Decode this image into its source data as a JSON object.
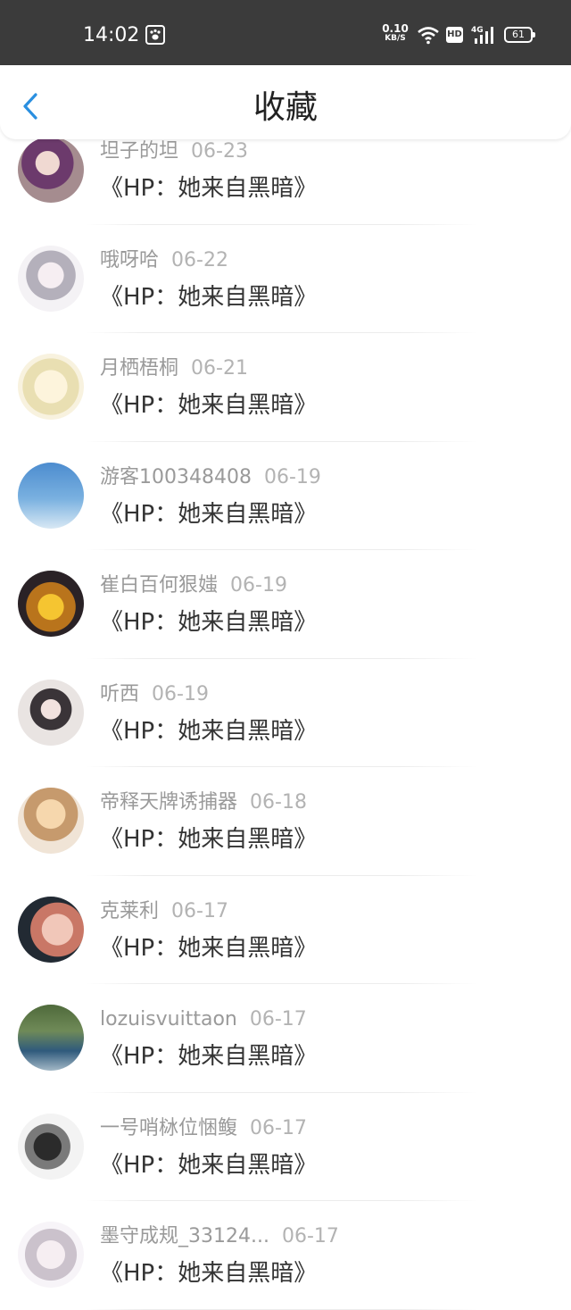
{
  "status_bar": {
    "time": "14:02",
    "net_speed": "0.10",
    "net_unit": "KB/S",
    "hd_label": "HD",
    "network": "4G",
    "battery": "61"
  },
  "header": {
    "title": "收藏"
  },
  "favorites": [
    {
      "user": "坦子的坦",
      "date": "06-23",
      "book": "《HP：她来自黑暗》"
    },
    {
      "user": "哦呀哈",
      "date": "06-22",
      "book": "《HP：她来自黑暗》"
    },
    {
      "user": "月栖梧桐",
      "date": "06-21",
      "book": "《HP：她来自黑暗》"
    },
    {
      "user": "游客100348408",
      "date": "06-19",
      "book": "《HP：她来自黑暗》"
    },
    {
      "user": "崔白百何狠媸",
      "date": "06-19",
      "book": "《HP：她来自黑暗》"
    },
    {
      "user": "听西",
      "date": "06-19",
      "book": "《HP：她来自黑暗》"
    },
    {
      "user": "帝释天牌诱捕器",
      "date": "06-18",
      "book": "《HP：她来自黑暗》"
    },
    {
      "user": "克莱利",
      "date": "06-17",
      "book": "《HP：她来自黑暗》"
    },
    {
      "user": "lozuisvuittaon",
      "date": "06-17",
      "book": "《HP：她来自黑暗》"
    },
    {
      "user": "一号哨栤位悃鳆",
      "date": "06-17",
      "book": "《HP：她来自黑暗》"
    },
    {
      "user": "墨守成规_33124...",
      "date": "06-17",
      "book": "《HP：她来自黑暗》"
    }
  ],
  "colors": {
    "status_bar_bg": "#3b3b3b",
    "accent_blue": "#2a8fe0",
    "title_text": "#222222",
    "meta_text": "#9a9a9a"
  }
}
